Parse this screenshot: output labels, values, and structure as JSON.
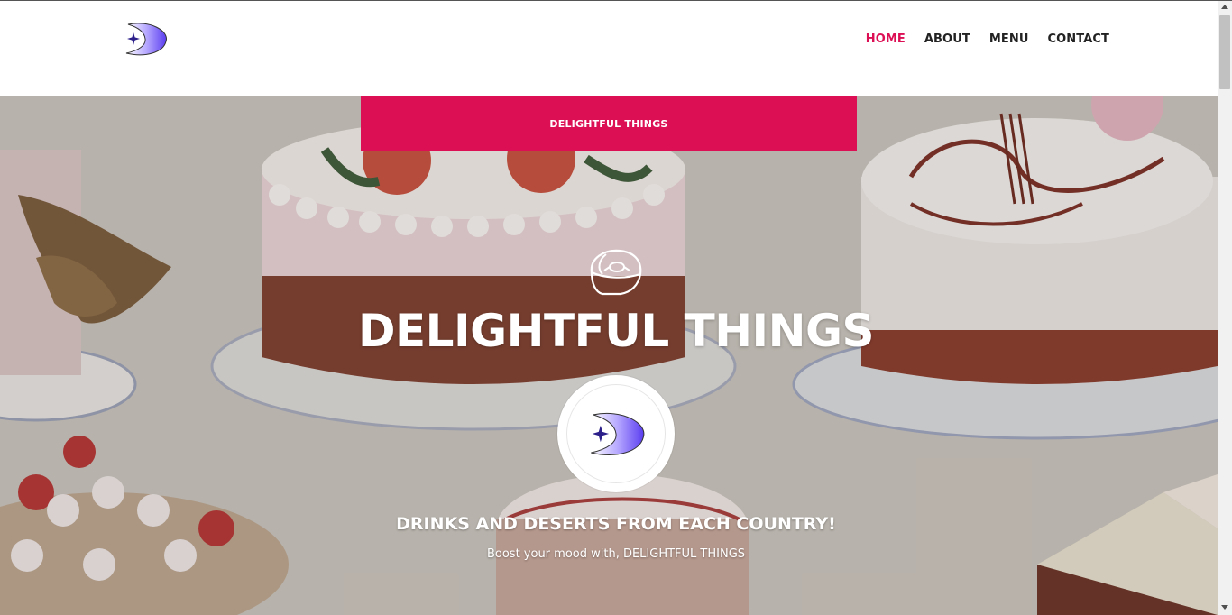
{
  "header": {
    "logo_icon": "crescent-star-logo-icon",
    "nav": [
      {
        "label": "HOME",
        "active": true
      },
      {
        "label": "ABOUT",
        "active": false
      },
      {
        "label": "MENU",
        "active": false
      },
      {
        "label": "CONTACT",
        "active": false
      }
    ]
  },
  "hero": {
    "banner_text": "DELIGHTFUL THINGS",
    "icon": "cake-outline-icon",
    "title": "DELIGHTFUL THINGS",
    "center_logo_icon": "crescent-star-logo-icon",
    "subtitle": "DRINKS AND DESERTS FROM EACH COUNTRY!",
    "tagline": "Boost your mood with, DELIGHTFUL THINGS",
    "background": "vintage-cakes-illustration"
  },
  "colors": {
    "accent": "#dc0f55",
    "logo_purple": "#6a4bf0",
    "nav_text": "#222222",
    "white": "#ffffff"
  }
}
